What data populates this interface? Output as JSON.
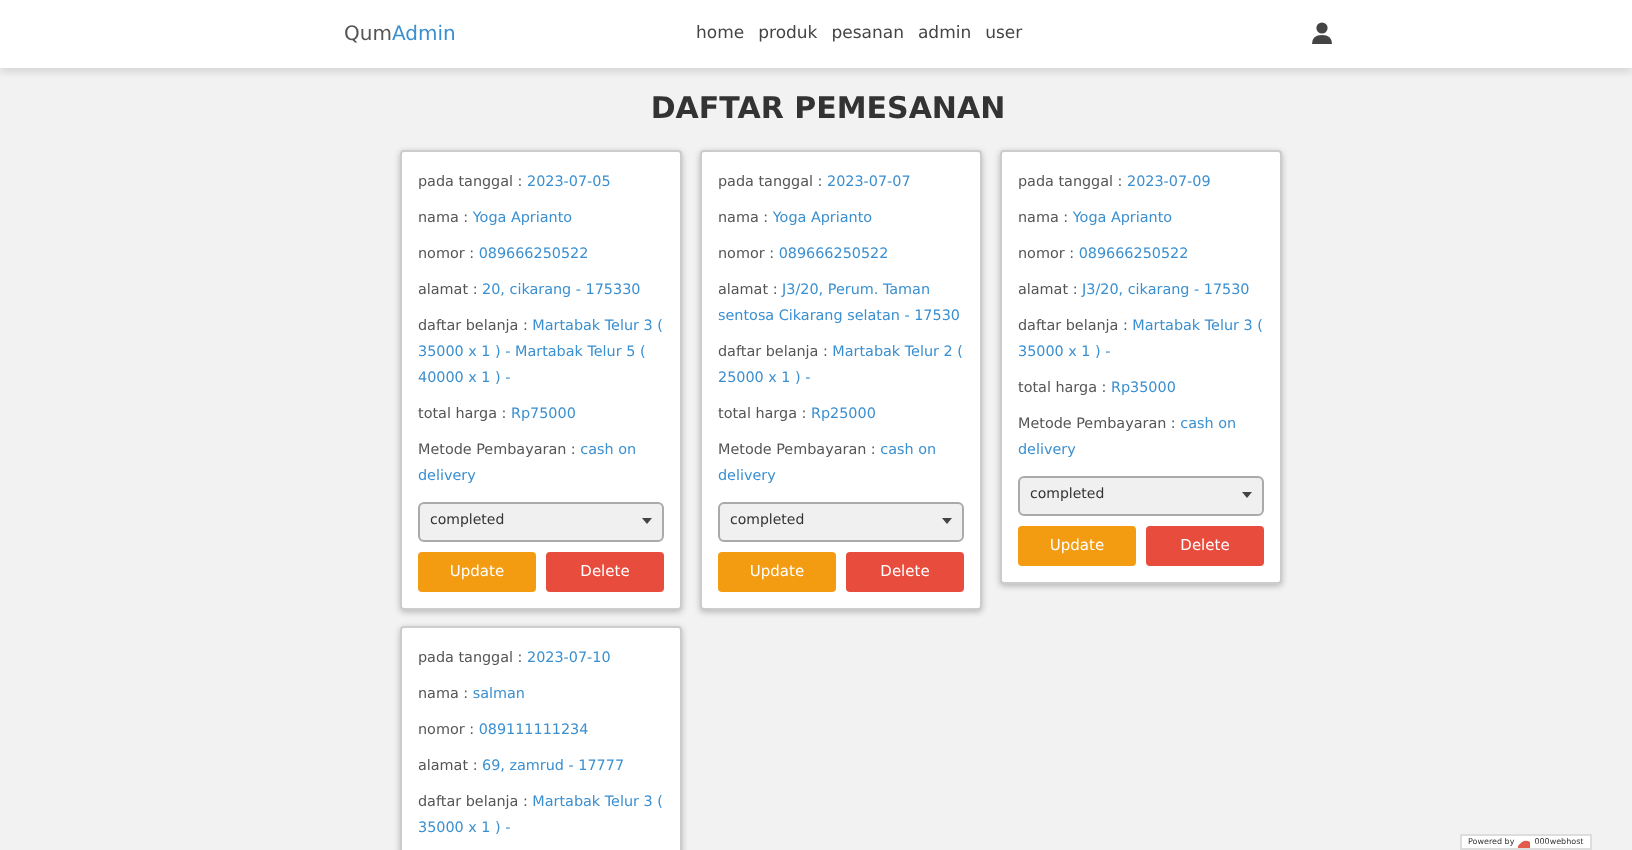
{
  "navbar": {
    "brand": [
      {
        "text": "Qum",
        "kind": "plain"
      },
      {
        "text": "Admin",
        "kind": "accent"
      }
    ],
    "links": [
      "home",
      "produk",
      "pesanan",
      "admin",
      "user"
    ]
  },
  "title": "DAFTAR PEMESANAN",
  "orders": [
    {
      "fields": [
        {
          "label": "pada tanggal :",
          "value": "2023-07-05"
        },
        {
          "label": "nama :",
          "value": "Yoga Aprianto"
        },
        {
          "label": "nomor :",
          "value": "089666250522"
        },
        {
          "label": "alamat :",
          "value": "20, cikarang - 175330"
        },
        {
          "label": "daftar belanja :",
          "value": "Martabak Telur 3 ( 35000 x 1 ) - Martabak Telur 5 ( 40000 x 1 ) -"
        },
        {
          "label": "total harga :",
          "value": "Rp75000"
        },
        {
          "label": "Metode Pembayaran :",
          "value": "cash on delivery"
        }
      ],
      "status": "completed",
      "buttons": [
        "Update",
        "Delete"
      ]
    },
    {
      "fields": [
        {
          "label": "pada tanggal :",
          "value": "2023-07-07"
        },
        {
          "label": "nama :",
          "value": "Yoga Aprianto"
        },
        {
          "label": "nomor :",
          "value": "089666250522"
        },
        {
          "label": "alamat :",
          "value": "J3/20, Perum. Taman sentosa Cikarang selatan - 17530"
        },
        {
          "label": "daftar belanja :",
          "value": "Martabak Telur 2 ( 25000 x 1 ) -"
        },
        {
          "label": "total harga :",
          "value": "Rp25000"
        },
        {
          "label": "Metode Pembayaran :",
          "value": "cash on delivery"
        }
      ],
      "status": "completed",
      "buttons": [
        "Update",
        "Delete"
      ]
    },
    {
      "fields": [
        {
          "label": "pada tanggal :",
          "value": "2023-07-09"
        },
        {
          "label": "nama :",
          "value": "Yoga Aprianto"
        },
        {
          "label": "nomor :",
          "value": "089666250522"
        },
        {
          "label": "alamat :",
          "value": "J3/20, cikarang - 17530"
        },
        {
          "label": "daftar belanja :",
          "value": "Martabak Telur 3 ( 35000 x 1 ) -"
        },
        {
          "label": "total harga :",
          "value": "Rp35000"
        },
        {
          "label": "Metode Pembayaran :",
          "value": "cash on delivery"
        }
      ],
      "status": "completed",
      "buttons": [
        "Update",
        "Delete"
      ]
    },
    {
      "fields": [
        {
          "label": "pada tanggal :",
          "value": "2023-07-10"
        },
        {
          "label": "nama :",
          "value": "salman"
        },
        {
          "label": "nomor :",
          "value": "089111111234"
        },
        {
          "label": "alamat :",
          "value": "69, zamrud - 17777"
        },
        {
          "label": "daftar belanja :",
          "value": "Martabak Telur 3 ( 35000 x 1 ) -"
        }
      ]
    }
  ],
  "badge": {
    "prefix": "Powered by",
    "host": "000webhost"
  }
}
